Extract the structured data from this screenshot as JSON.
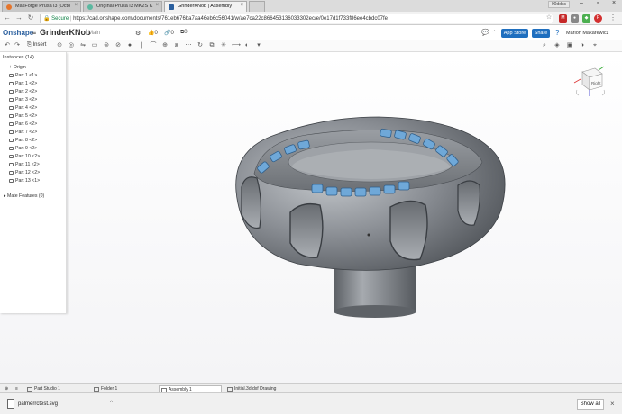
{
  "browser": {
    "tabs": [
      {
        "label": "MakForge Prusa i3 [Octo"
      },
      {
        "label": "Original Prusa i3 MK2S K"
      },
      {
        "label": "GrinderKNob | Assembly"
      }
    ],
    "window_label": "00ddss",
    "url_secure": "Secure",
    "url_text": "https://cad.onshape.com/documents/761eb676ba7aa46eb6c56041/w/ae7ca22c866453136033302ec/e/0e17d1f733f86ee4cbdc07fe"
  },
  "app": {
    "logo": "Onshape",
    "doc_title": "GrinderKNob",
    "branch": "Main",
    "counters": [
      "0",
      "0",
      "0"
    ],
    "app_store": "App Store",
    "share": "Share",
    "user": "Marion Makarewicz",
    "insert": "Insert"
  },
  "tree": {
    "header": "Instances (14)",
    "items": [
      "Origin",
      "Part 1 <1>",
      "Part 1 <2>",
      "Part 2 <2>",
      "Part 3 <2>",
      "Part 4 <2>",
      "Part 5 <2>",
      "Part 6 <2>",
      "Part 7 <2>",
      "Part 8 <2>",
      "Part 9 <2>",
      "Part 10 <2>",
      "Part 11 <2>",
      "Part 12 <2>",
      "Part 13 <1>"
    ],
    "mate_features": "Mate Features (0)"
  },
  "view_cube": {
    "face": "Right"
  },
  "bottom_tabs": [
    {
      "label": "Part Studio 1"
    },
    {
      "label": "Folder 1"
    },
    {
      "label": "Assembly 1"
    },
    {
      "label": "Initial.3d.dxf Drawing"
    }
  ],
  "downloads": {
    "file": "palmerrctest.svg",
    "show_all": "Show all"
  },
  "colors": {
    "knob_body": "#8a8e94",
    "letters": "#6fa8d8",
    "accent": "#1f6fbf"
  }
}
